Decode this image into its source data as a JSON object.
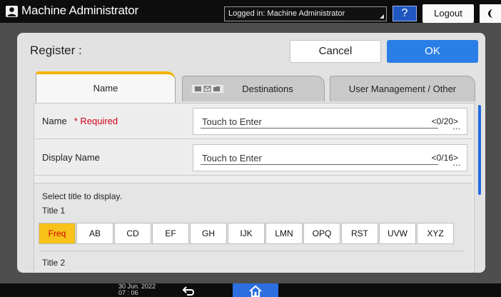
{
  "topbar": {
    "user_name": "Machine Administrator",
    "login_status": "Logged in: Machine Administrator",
    "help_label": "?",
    "logout_label": "Logout"
  },
  "header": {
    "title": "Register :",
    "cancel_label": "Cancel",
    "ok_label": "OK"
  },
  "tabs": [
    {
      "label": "Name",
      "active": true
    },
    {
      "label": "Destinations",
      "active": false
    },
    {
      "label": "User Management / Other",
      "active": false
    }
  ],
  "fields": [
    {
      "label": "Name",
      "required_text": "* Required",
      "placeholder": "Touch to Enter",
      "count": "<0/20>"
    },
    {
      "label": "Display Name",
      "placeholder": "Touch to Enter",
      "count": "<0/16>"
    }
  ],
  "title_section": {
    "intro": "Select title to display.",
    "title1_label": "Title 1",
    "title2_label": "Title 2",
    "buttons": [
      "Freq",
      "AB",
      "CD",
      "EF",
      "GH",
      "IJK",
      "LMN",
      "OPQ",
      "RST",
      "UVW",
      "XYZ"
    ],
    "selected": "Freq"
  },
  "bottombar": {
    "date": "30 Jun. 2022",
    "time": "07 : 06"
  },
  "colors": {
    "accent_blue": "#2a7ee6",
    "tab_highlight": "#f2b400",
    "selected_button": "#f8c21a",
    "required_red": "#d0021b"
  }
}
